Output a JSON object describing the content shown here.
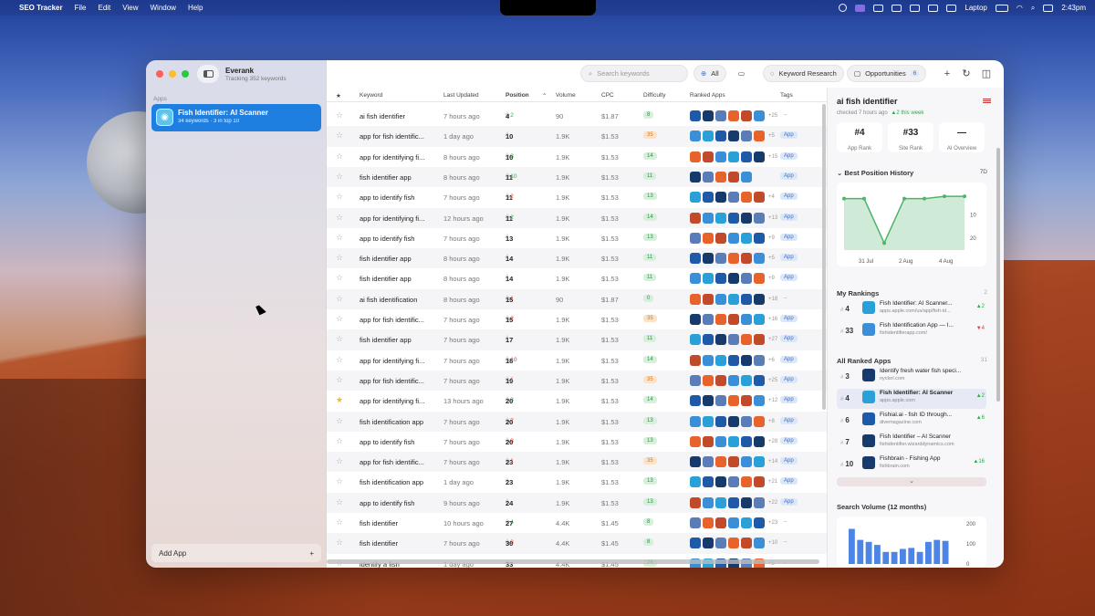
{
  "menubar": {
    "app": "SEO Tracker",
    "items": [
      "File",
      "Edit",
      "View",
      "Window",
      "Help"
    ],
    "laptop": "Laptop",
    "time": "2:43pm"
  },
  "workspace": {
    "name": "Everank",
    "subtitle": "Tracking 352 keywords"
  },
  "sidebar": {
    "section": "Apps",
    "app_name": "Fish Identifier: AI Scanner",
    "app_meta": "34 keywords · 3 in top 10",
    "add_app": "Add App",
    "add_icon": "+"
  },
  "toolbar": {
    "search_placeholder": "Search keywords",
    "all": "All",
    "keyword_research": "Keyword Research",
    "opportunities": "Opportunities",
    "opp_count": "6"
  },
  "columns": {
    "star": "★",
    "keyword": "Keyword",
    "updated": "Last Updated",
    "position": "Position",
    "volume": "Volume",
    "cpc": "CPC",
    "difficulty": "Difficulty",
    "ranked": "Ranked Apps",
    "tags": "Tags"
  },
  "rows": [
    {
      "kw": "ai fish identifier",
      "upd": "7 hours ago",
      "pos": "4",
      "chg": "↑2",
      "dir": "up",
      "vol": "90",
      "cpc": "$1.87",
      "diff": "8",
      "dc": "g",
      "more": "+25",
      "tag": "–",
      "fav": false
    },
    {
      "kw": "app for fish identific...",
      "upd": "1 day ago",
      "pos": "10",
      "chg": "",
      "dir": "",
      "vol": "1.9K",
      "cpc": "$1.53",
      "diff": "35",
      "dc": "o",
      "more": "+5",
      "tag": "App",
      "fav": false
    },
    {
      "kw": "app for identifying fi...",
      "upd": "8 hours ago",
      "pos": "10",
      "chg": "↑8",
      "dir": "up",
      "vol": "1.9K",
      "cpc": "$1.53",
      "diff": "14",
      "dc": "g",
      "more": "+15",
      "tag": "App",
      "fav": false
    },
    {
      "kw": "fish identifier app",
      "upd": "8 hours ago",
      "pos": "11",
      "chg": "↑10",
      "dir": "up",
      "vol": "1.9K",
      "cpc": "$1.53",
      "diff": "11",
      "dc": "g",
      "more": "",
      "tag": "App",
      "fav": false
    },
    {
      "kw": "app to identify fish",
      "upd": "7 hours ago",
      "pos": "11",
      "chg": "↓2",
      "dir": "dn",
      "vol": "1.9K",
      "cpc": "$1.53",
      "diff": "13",
      "dc": "g",
      "more": "+4",
      "tag": "App",
      "fav": false
    },
    {
      "kw": "app for identifying fi...",
      "upd": "12 hours ago",
      "pos": "11",
      "chg": "↑2",
      "dir": "up",
      "vol": "1.9K",
      "cpc": "$1.53",
      "diff": "14",
      "dc": "g",
      "more": "+13",
      "tag": "App",
      "fav": false
    },
    {
      "kw": "app to identify fish",
      "upd": "7 hours ago",
      "pos": "13",
      "chg": "",
      "dir": "",
      "vol": "1.9K",
      "cpc": "$1.53",
      "diff": "13",
      "dc": "g",
      "more": "+9",
      "tag": "App",
      "fav": false
    },
    {
      "kw": "fish identifier app",
      "upd": "8 hours ago",
      "pos": "14",
      "chg": "",
      "dir": "",
      "vol": "1.9K",
      "cpc": "$1.53",
      "diff": "11",
      "dc": "g",
      "more": "+5",
      "tag": "App",
      "fav": false
    },
    {
      "kw": "fish identifier app",
      "upd": "8 hours ago",
      "pos": "14",
      "chg": "",
      "dir": "",
      "vol": "1.9K",
      "cpc": "$1.53",
      "diff": "11",
      "dc": "g",
      "more": "+9",
      "tag": "App",
      "fav": false
    },
    {
      "kw": "ai fish identification",
      "upd": "8 hours ago",
      "pos": "15",
      "chg": "↓1",
      "dir": "dn",
      "vol": "90",
      "cpc": "$1.87",
      "diff": "0",
      "dc": "g",
      "more": "+18",
      "tag": "–",
      "fav": false
    },
    {
      "kw": "app for fish identific...",
      "upd": "7 hours ago",
      "pos": "15",
      "chg": "↓2",
      "dir": "dn",
      "vol": "1.9K",
      "cpc": "$1.53",
      "diff": "35",
      "dc": "o",
      "more": "+16",
      "tag": "App",
      "fav": false
    },
    {
      "kw": "fish identifier app",
      "upd": "7 hours ago",
      "pos": "17",
      "chg": "",
      "dir": "",
      "vol": "1.9K",
      "cpc": "$1.53",
      "diff": "11",
      "dc": "g",
      "more": "+27",
      "tag": "App",
      "fav": false
    },
    {
      "kw": "app for identifying fi...",
      "upd": "7 hours ago",
      "pos": "18",
      "chg": "↓10",
      "dir": "dn",
      "vol": "1.9K",
      "cpc": "$1.53",
      "diff": "14",
      "dc": "g",
      "more": "+6",
      "tag": "App",
      "fav": false
    },
    {
      "kw": "app for fish identific...",
      "upd": "7 hours ago",
      "pos": "19",
      "chg": "↓1",
      "dir": "dn",
      "vol": "1.9K",
      "cpc": "$1.53",
      "diff": "35",
      "dc": "o",
      "more": "+25",
      "tag": "App",
      "fav": false
    },
    {
      "kw": "app for identifying fi...",
      "upd": "13 hours ago",
      "pos": "20",
      "chg": "↑3",
      "dir": "up",
      "vol": "1.9K",
      "cpc": "$1.53",
      "diff": "14",
      "dc": "g",
      "more": "+12",
      "tag": "App",
      "fav": true
    },
    {
      "kw": "fish identification app",
      "upd": "7 hours ago",
      "pos": "20",
      "chg": "↓7",
      "dir": "dn",
      "vol": "1.9K",
      "cpc": "$1.53",
      "diff": "13",
      "dc": "g",
      "more": "+8",
      "tag": "App",
      "fav": false
    },
    {
      "kw": "app to identify fish",
      "upd": "7 hours ago",
      "pos": "20",
      "chg": "↓8",
      "dir": "dn",
      "vol": "1.9K",
      "cpc": "$1.53",
      "diff": "13",
      "dc": "g",
      "more": "+28",
      "tag": "App",
      "fav": false
    },
    {
      "kw": "app for fish identific...",
      "upd": "7 hours ago",
      "pos": "23",
      "chg": "↓1",
      "dir": "dn",
      "vol": "1.9K",
      "cpc": "$1.53",
      "diff": "35",
      "dc": "o",
      "more": "+14",
      "tag": "App",
      "fav": false
    },
    {
      "kw": "fish identification app",
      "upd": "1 day ago",
      "pos": "23",
      "chg": "",
      "dir": "",
      "vol": "1.9K",
      "cpc": "$1.53",
      "diff": "13",
      "dc": "g",
      "more": "+21",
      "tag": "App",
      "fav": false
    },
    {
      "kw": "app to identify fish",
      "upd": "9 hours ago",
      "pos": "24",
      "chg": "",
      "dir": "",
      "vol": "1.9K",
      "cpc": "$1.53",
      "diff": "13",
      "dc": "g",
      "more": "+22",
      "tag": "App",
      "fav": false
    },
    {
      "kw": "fish identifier",
      "upd": "10 hours ago",
      "pos": "27",
      "chg": "↑4",
      "dir": "up",
      "vol": "4.4K",
      "cpc": "$1.45",
      "diff": "8",
      "dc": "g",
      "more": "+23",
      "tag": "–",
      "fav": false
    },
    {
      "kw": "fish identifier",
      "upd": "7 hours ago",
      "pos": "30",
      "chg": "↓8",
      "dir": "dn",
      "vol": "4.4K",
      "cpc": "$1.45",
      "diff": "8",
      "dc": "g",
      "more": "+10",
      "tag": "–",
      "fav": false
    },
    {
      "kw": "identify a fish",
      "upd": "1 day ago",
      "pos": "33",
      "chg": "",
      "dir": "",
      "vol": "4.4K",
      "cpc": "$1.45",
      "diff": "26",
      "dc": "g",
      "more": "+5",
      "tag": "–",
      "fav": false
    }
  ],
  "app_icon_colors": [
    "#1e5aa8",
    "#3a8fd8",
    "#e8622c",
    "#163a6b",
    "#2aa0d8",
    "#c04a2a",
    "#5a7db8"
  ],
  "detail": {
    "title": "ai fish identifier",
    "checked": "checked 7 hours ago",
    "change": "▲2 this week",
    "stats": [
      {
        "v": "#4",
        "l": "App Rank"
      },
      {
        "v": "#33",
        "l": "Site Rank"
      },
      {
        "v": "—",
        "l": "AI Overview"
      }
    ],
    "history_title": "Best Position History",
    "range": "7D",
    "history": {
      "x": [
        "31 Jul",
        "",
        "2 Aug",
        "",
        "4 Aug",
        ""
      ],
      "y": [
        3,
        3,
        22,
        3,
        3,
        2,
        2
      ],
      "yticks": [
        "10",
        "20"
      ]
    },
    "my_rankings": "My Rankings",
    "my_count": "2",
    "mine": [
      {
        "n": "4",
        "a": "Fish Identifier: AI Scanner...",
        "b": "apps.apple.com/us/app/fish-id...",
        "c": "▲2",
        "d": "up",
        "col": "#2aa0d8"
      },
      {
        "n": "33",
        "a": "Fish Identification App — I...",
        "b": "fishidentifierapp.com/",
        "c": "▼4",
        "d": "dn",
        "col": "#3a8fd8"
      }
    ],
    "all_title": "All Ranked Apps",
    "all_count": "31",
    "all": [
      {
        "n": "3",
        "a": "Identify fresh water fish speci...",
        "b": "nyckel.com",
        "c": "",
        "d": "",
        "col": "#163a6b"
      },
      {
        "n": "4",
        "a": "Fish Identifier: AI Scanner",
        "b": "apps.apple.com",
        "c": "▲2",
        "d": "up",
        "col": "#2aa0d8"
      },
      {
        "n": "6",
        "a": "Fishial.ai - fish ID through...",
        "b": "divemagazine.com",
        "c": "▲6",
        "d": "up",
        "col": "#1e5aa8"
      },
      {
        "n": "7",
        "a": "Fish Identifier – AI Scanner",
        "b": "fishidentifier.wizarddynamics.com",
        "c": "",
        "d": "",
        "col": "#163a6b"
      },
      {
        "n": "10",
        "a": "Fishbrain - Fishing App",
        "b": "fishbrain.com",
        "c": "▲16",
        "d": "up",
        "col": "#163a6b"
      }
    ],
    "sv_title": "Search Volume (12 months)",
    "sv": {
      "values": [
        175,
        120,
        110,
        95,
        60,
        60,
        75,
        80,
        60,
        110,
        120,
        115
      ],
      "yticks": [
        "200",
        "100",
        "0"
      ]
    }
  }
}
